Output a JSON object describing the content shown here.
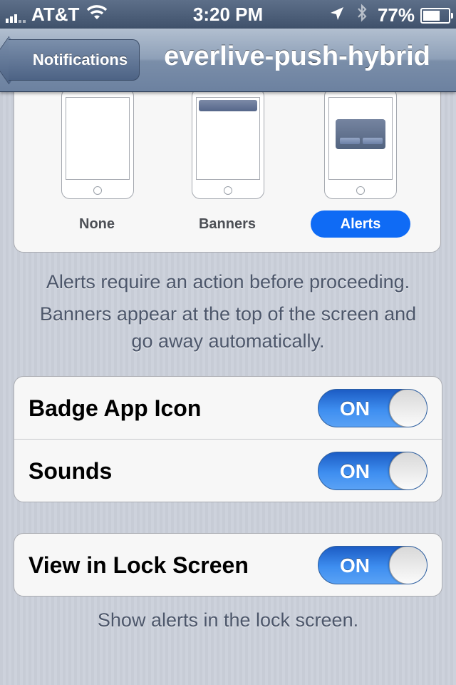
{
  "status_bar": {
    "carrier": "AT&T",
    "time": "3:20 PM",
    "battery_percent": "77%",
    "battery_level": 0.77,
    "icons": [
      "signal-icon",
      "wifi-icon",
      "location-icon",
      "bluetooth-icon",
      "battery-icon"
    ]
  },
  "nav": {
    "back_label": "Notifications",
    "title": "everlive-push-hybrid"
  },
  "alert_style": {
    "options": [
      {
        "label": "None",
        "selected": false
      },
      {
        "label": "Banners",
        "selected": false
      },
      {
        "label": "Alerts",
        "selected": true
      }
    ],
    "selected_color": "#0f6bf5"
  },
  "notes": {
    "alerts_line": "Alerts require an action before proceeding.",
    "banners_line1": "Banners appear at the top of the screen and",
    "banners_line2": "go away automatically.",
    "lock_screen": "Show alerts in the lock screen."
  },
  "settings": {
    "badge_app_icon": {
      "label": "Badge App Icon",
      "value": "ON"
    },
    "sounds": {
      "label": "Sounds",
      "value": "ON"
    },
    "view_in_lock_screen": {
      "label": "View in Lock Screen",
      "value": "ON"
    }
  },
  "colors": {
    "toggle_on": "#3e8ef0",
    "nav_bar": "#8ea0b8",
    "status_bar": "#4b5d78"
  }
}
